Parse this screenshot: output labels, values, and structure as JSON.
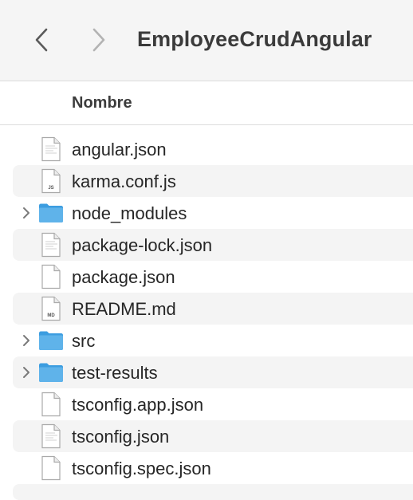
{
  "window": {
    "title": "EmployeeCrudAngular"
  },
  "toolbar": {
    "back_icon": "chevron-left-icon",
    "forward_icon": "chevron-right-icon"
  },
  "columns": {
    "name": "Nombre"
  },
  "files": [
    {
      "name": "angular.json",
      "kind": "file",
      "badge": ""
    },
    {
      "name": "karma.conf.js",
      "kind": "file",
      "badge": "JS"
    },
    {
      "name": "node_modules",
      "kind": "folder",
      "badge": ""
    },
    {
      "name": "package-lock.json",
      "kind": "file",
      "badge": ""
    },
    {
      "name": "package.json",
      "kind": "file",
      "badge": ""
    },
    {
      "name": "README.md",
      "kind": "file",
      "badge": "MD"
    },
    {
      "name": "src",
      "kind": "folder",
      "badge": ""
    },
    {
      "name": "test-results",
      "kind": "folder",
      "badge": ""
    },
    {
      "name": "tsconfig.app.json",
      "kind": "file",
      "badge": ""
    },
    {
      "name": "tsconfig.json",
      "kind": "file",
      "badge": ""
    },
    {
      "name": "tsconfig.spec.json",
      "kind": "file",
      "badge": ""
    }
  ],
  "colors": {
    "toolbar_bg": "#f5f5f5",
    "row_alt_bg": "#f4f4f4",
    "folder_blue": "#5fb3ea",
    "folder_dark": "#3c9de0"
  }
}
